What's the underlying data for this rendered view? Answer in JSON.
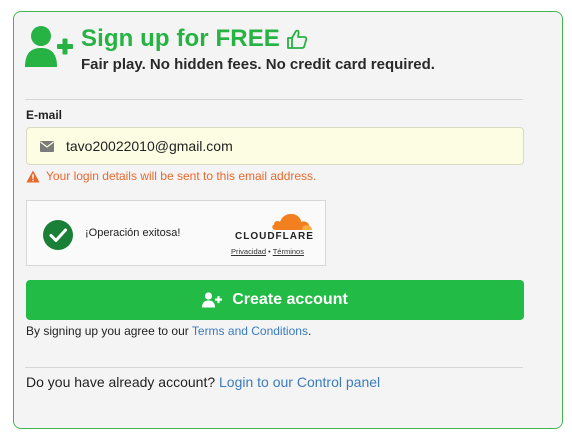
{
  "header": {
    "title": "Sign up for FREE",
    "subtitle": "Fair play. No hidden fees. No credit card required."
  },
  "form": {
    "email_label": "E-mail",
    "email_value": "tavo20022010@gmail.com",
    "warning": "Your login details will be sent to this email address."
  },
  "captcha": {
    "status": "¡Operación exitosa!",
    "brand": "CLOUDFLARE",
    "privacy_link": "Privacidad",
    "separator": " • ",
    "terms_link": "Términos"
  },
  "actions": {
    "create_label": "Create account"
  },
  "terms": {
    "prefix": "By signing up you agree to our ",
    "link": "Terms and Conditions",
    "suffix": "."
  },
  "login": {
    "prefix": "Do you have already account? ",
    "link": "Login to our Control panel"
  },
  "colors": {
    "accent": "#27b244",
    "button": "#22bb45",
    "warning": "#e8692d",
    "link": "#3b7bbf",
    "cloudflare": "#f38020"
  },
  "icons": [
    "add-user-icon",
    "thumbs-up-icon",
    "envelope-icon",
    "warning-icon",
    "check-circle-icon",
    "cloudflare-logo"
  ]
}
